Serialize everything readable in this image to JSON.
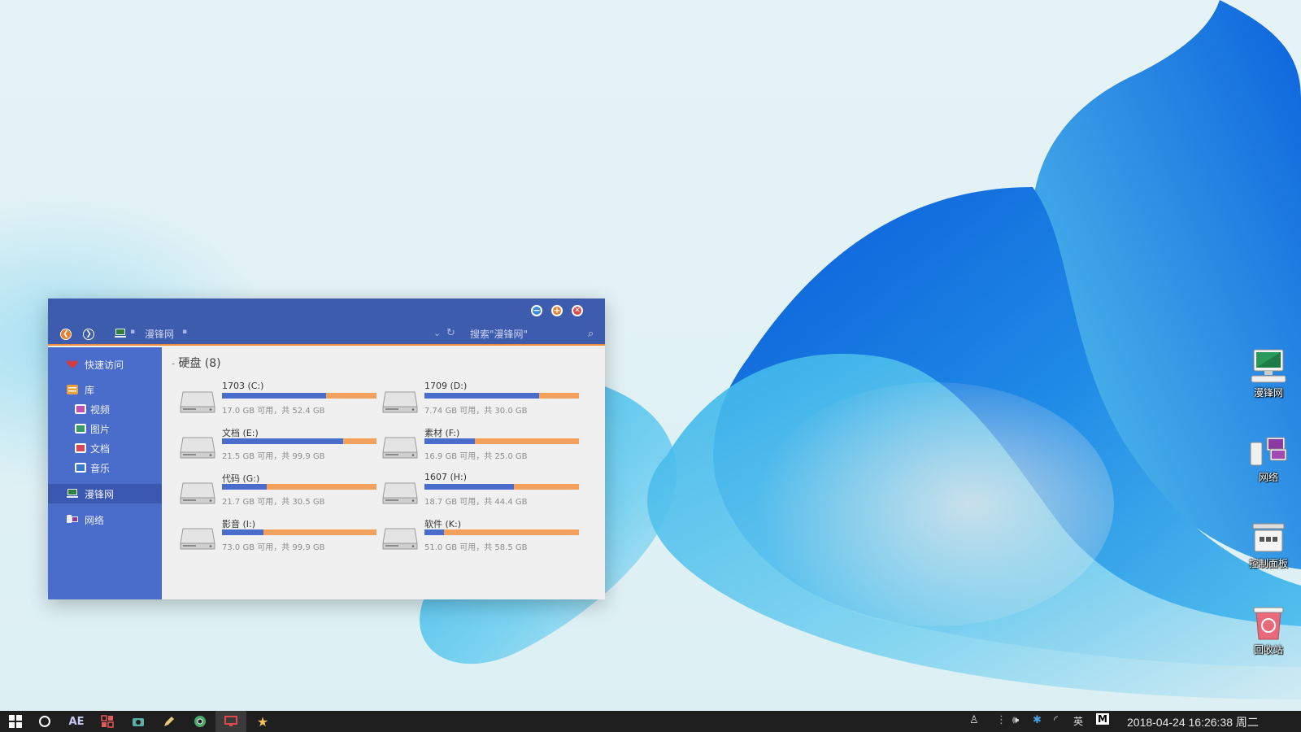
{
  "explorer": {
    "address": "漫锋网",
    "search_placeholder": "搜索\"漫锋网\"",
    "group_title": "硬盘 (8)",
    "sidebar": [
      {
        "label": "快速访问",
        "icon": "heart-icon"
      },
      {
        "label": "库",
        "icon": "library-icon"
      },
      {
        "label": "视频",
        "icon": "video-icon"
      },
      {
        "label": "图片",
        "icon": "picture-icon"
      },
      {
        "label": "文档",
        "icon": "document-icon"
      },
      {
        "label": "音乐",
        "icon": "music-icon"
      },
      {
        "label": "漫锋网",
        "icon": "computer-icon",
        "active": true
      },
      {
        "label": "网络",
        "icon": "network-icon"
      }
    ],
    "drives": [
      {
        "name": "1703 (C:)",
        "free": "17.0 GB 可用，共 52.4 GB",
        "used_fraction": 0.676
      },
      {
        "name": "1709 (D:)",
        "free": "7.74 GB 可用，共 30.0 GB",
        "used_fraction": 0.742
      },
      {
        "name": "文档 (E:)",
        "free": "21.5 GB 可用，共 99.9 GB",
        "used_fraction": 0.785
      },
      {
        "name": "素材 (F:)",
        "free": "16.9 GB 可用，共 25.0 GB",
        "used_fraction": 0.324
      },
      {
        "name": "代码 (G:)",
        "free": "21.7 GB 可用，共 30.5 GB",
        "used_fraction": 0.289
      },
      {
        "name": "1607 (H:)",
        "free": "18.7 GB 可用，共 44.4 GB",
        "used_fraction": 0.579
      },
      {
        "name": "影音 (I:)",
        "free": "73.0 GB 可用，共 99.9 GB",
        "used_fraction": 0.269
      },
      {
        "name": "软件 (K:)",
        "free": "51.0 GB 可用，共 58.5 GB",
        "used_fraction": 0.128
      }
    ]
  },
  "desktop_icons": [
    {
      "label": "漫锋网",
      "icon": "computer-icon"
    },
    {
      "label": "网络",
      "icon": "network-icon"
    },
    {
      "label": "控制面板",
      "icon": "control-panel-icon"
    },
    {
      "label": "回收站",
      "icon": "recycle-bin-icon"
    }
  ],
  "taskbar": {
    "apps": [
      {
        "icon": "windows-start-icon"
      },
      {
        "icon": "cortana-circle-icon"
      },
      {
        "icon": "after-effects-icon",
        "text": "AE"
      },
      {
        "icon": "apps-grid-icon"
      },
      {
        "icon": "camera-icon"
      },
      {
        "icon": "pen-icon"
      },
      {
        "icon": "chrome-icon"
      },
      {
        "icon": "monitor-icon",
        "active": true
      },
      {
        "icon": "star-icon"
      }
    ],
    "tray": {
      "ime_label": "英",
      "m_label": "M"
    },
    "clock": "2018-04-24  16:26:38  周二"
  },
  "colors": {
    "window_blue": "#3e5cae",
    "sidebar_blue": "#4a6ccb",
    "accent_orange": "#f08a3c",
    "bar_used": "#4a6ccb",
    "bar_free": "#f5a15e"
  }
}
